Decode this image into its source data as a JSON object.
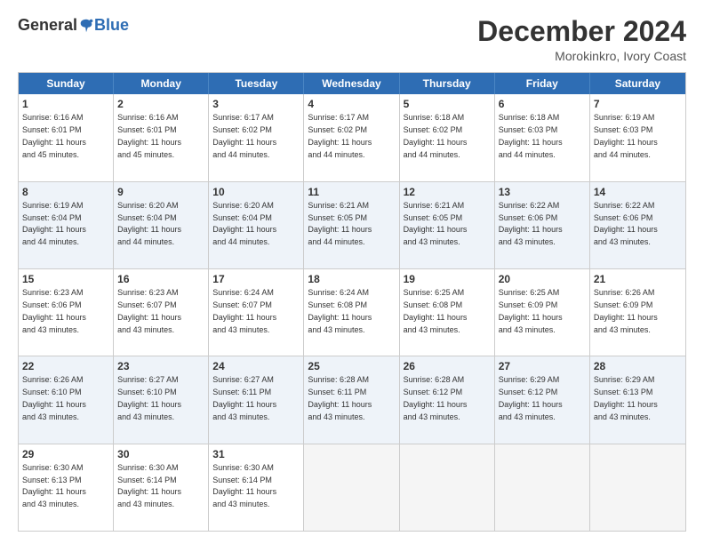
{
  "header": {
    "logo_general": "General",
    "logo_blue": "Blue",
    "month_title": "December 2024",
    "location": "Morokinkro, Ivory Coast"
  },
  "weekdays": [
    "Sunday",
    "Monday",
    "Tuesday",
    "Wednesday",
    "Thursday",
    "Friday",
    "Saturday"
  ],
  "rows": [
    {
      "alt": false,
      "cells": [
        {
          "day": "1",
          "info": "Sunrise: 6:16 AM\nSunset: 6:01 PM\nDaylight: 11 hours\nand 45 minutes."
        },
        {
          "day": "2",
          "info": "Sunrise: 6:16 AM\nSunset: 6:01 PM\nDaylight: 11 hours\nand 45 minutes."
        },
        {
          "day": "3",
          "info": "Sunrise: 6:17 AM\nSunset: 6:02 PM\nDaylight: 11 hours\nand 44 minutes."
        },
        {
          "day": "4",
          "info": "Sunrise: 6:17 AM\nSunset: 6:02 PM\nDaylight: 11 hours\nand 44 minutes."
        },
        {
          "day": "5",
          "info": "Sunrise: 6:18 AM\nSunset: 6:02 PM\nDaylight: 11 hours\nand 44 minutes."
        },
        {
          "day": "6",
          "info": "Sunrise: 6:18 AM\nSunset: 6:03 PM\nDaylight: 11 hours\nand 44 minutes."
        },
        {
          "day": "7",
          "info": "Sunrise: 6:19 AM\nSunset: 6:03 PM\nDaylight: 11 hours\nand 44 minutes."
        }
      ]
    },
    {
      "alt": true,
      "cells": [
        {
          "day": "8",
          "info": "Sunrise: 6:19 AM\nSunset: 6:04 PM\nDaylight: 11 hours\nand 44 minutes."
        },
        {
          "day": "9",
          "info": "Sunrise: 6:20 AM\nSunset: 6:04 PM\nDaylight: 11 hours\nand 44 minutes."
        },
        {
          "day": "10",
          "info": "Sunrise: 6:20 AM\nSunset: 6:04 PM\nDaylight: 11 hours\nand 44 minutes."
        },
        {
          "day": "11",
          "info": "Sunrise: 6:21 AM\nSunset: 6:05 PM\nDaylight: 11 hours\nand 44 minutes."
        },
        {
          "day": "12",
          "info": "Sunrise: 6:21 AM\nSunset: 6:05 PM\nDaylight: 11 hours\nand 43 minutes."
        },
        {
          "day": "13",
          "info": "Sunrise: 6:22 AM\nSunset: 6:06 PM\nDaylight: 11 hours\nand 43 minutes."
        },
        {
          "day": "14",
          "info": "Sunrise: 6:22 AM\nSunset: 6:06 PM\nDaylight: 11 hours\nand 43 minutes."
        }
      ]
    },
    {
      "alt": false,
      "cells": [
        {
          "day": "15",
          "info": "Sunrise: 6:23 AM\nSunset: 6:06 PM\nDaylight: 11 hours\nand 43 minutes."
        },
        {
          "day": "16",
          "info": "Sunrise: 6:23 AM\nSunset: 6:07 PM\nDaylight: 11 hours\nand 43 minutes."
        },
        {
          "day": "17",
          "info": "Sunrise: 6:24 AM\nSunset: 6:07 PM\nDaylight: 11 hours\nand 43 minutes."
        },
        {
          "day": "18",
          "info": "Sunrise: 6:24 AM\nSunset: 6:08 PM\nDaylight: 11 hours\nand 43 minutes."
        },
        {
          "day": "19",
          "info": "Sunrise: 6:25 AM\nSunset: 6:08 PM\nDaylight: 11 hours\nand 43 minutes."
        },
        {
          "day": "20",
          "info": "Sunrise: 6:25 AM\nSunset: 6:09 PM\nDaylight: 11 hours\nand 43 minutes."
        },
        {
          "day": "21",
          "info": "Sunrise: 6:26 AM\nSunset: 6:09 PM\nDaylight: 11 hours\nand 43 minutes."
        }
      ]
    },
    {
      "alt": true,
      "cells": [
        {
          "day": "22",
          "info": "Sunrise: 6:26 AM\nSunset: 6:10 PM\nDaylight: 11 hours\nand 43 minutes."
        },
        {
          "day": "23",
          "info": "Sunrise: 6:27 AM\nSunset: 6:10 PM\nDaylight: 11 hours\nand 43 minutes."
        },
        {
          "day": "24",
          "info": "Sunrise: 6:27 AM\nSunset: 6:11 PM\nDaylight: 11 hours\nand 43 minutes."
        },
        {
          "day": "25",
          "info": "Sunrise: 6:28 AM\nSunset: 6:11 PM\nDaylight: 11 hours\nand 43 minutes."
        },
        {
          "day": "26",
          "info": "Sunrise: 6:28 AM\nSunset: 6:12 PM\nDaylight: 11 hours\nand 43 minutes."
        },
        {
          "day": "27",
          "info": "Sunrise: 6:29 AM\nSunset: 6:12 PM\nDaylight: 11 hours\nand 43 minutes."
        },
        {
          "day": "28",
          "info": "Sunrise: 6:29 AM\nSunset: 6:13 PM\nDaylight: 11 hours\nand 43 minutes."
        }
      ]
    },
    {
      "alt": false,
      "cells": [
        {
          "day": "29",
          "info": "Sunrise: 6:30 AM\nSunset: 6:13 PM\nDaylight: 11 hours\nand 43 minutes."
        },
        {
          "day": "30",
          "info": "Sunrise: 6:30 AM\nSunset: 6:14 PM\nDaylight: 11 hours\nand 43 minutes."
        },
        {
          "day": "31",
          "info": "Sunrise: 6:30 AM\nSunset: 6:14 PM\nDaylight: 11 hours\nand 43 minutes."
        },
        {
          "day": "",
          "info": ""
        },
        {
          "day": "",
          "info": ""
        },
        {
          "day": "",
          "info": ""
        },
        {
          "day": "",
          "info": ""
        }
      ]
    }
  ]
}
